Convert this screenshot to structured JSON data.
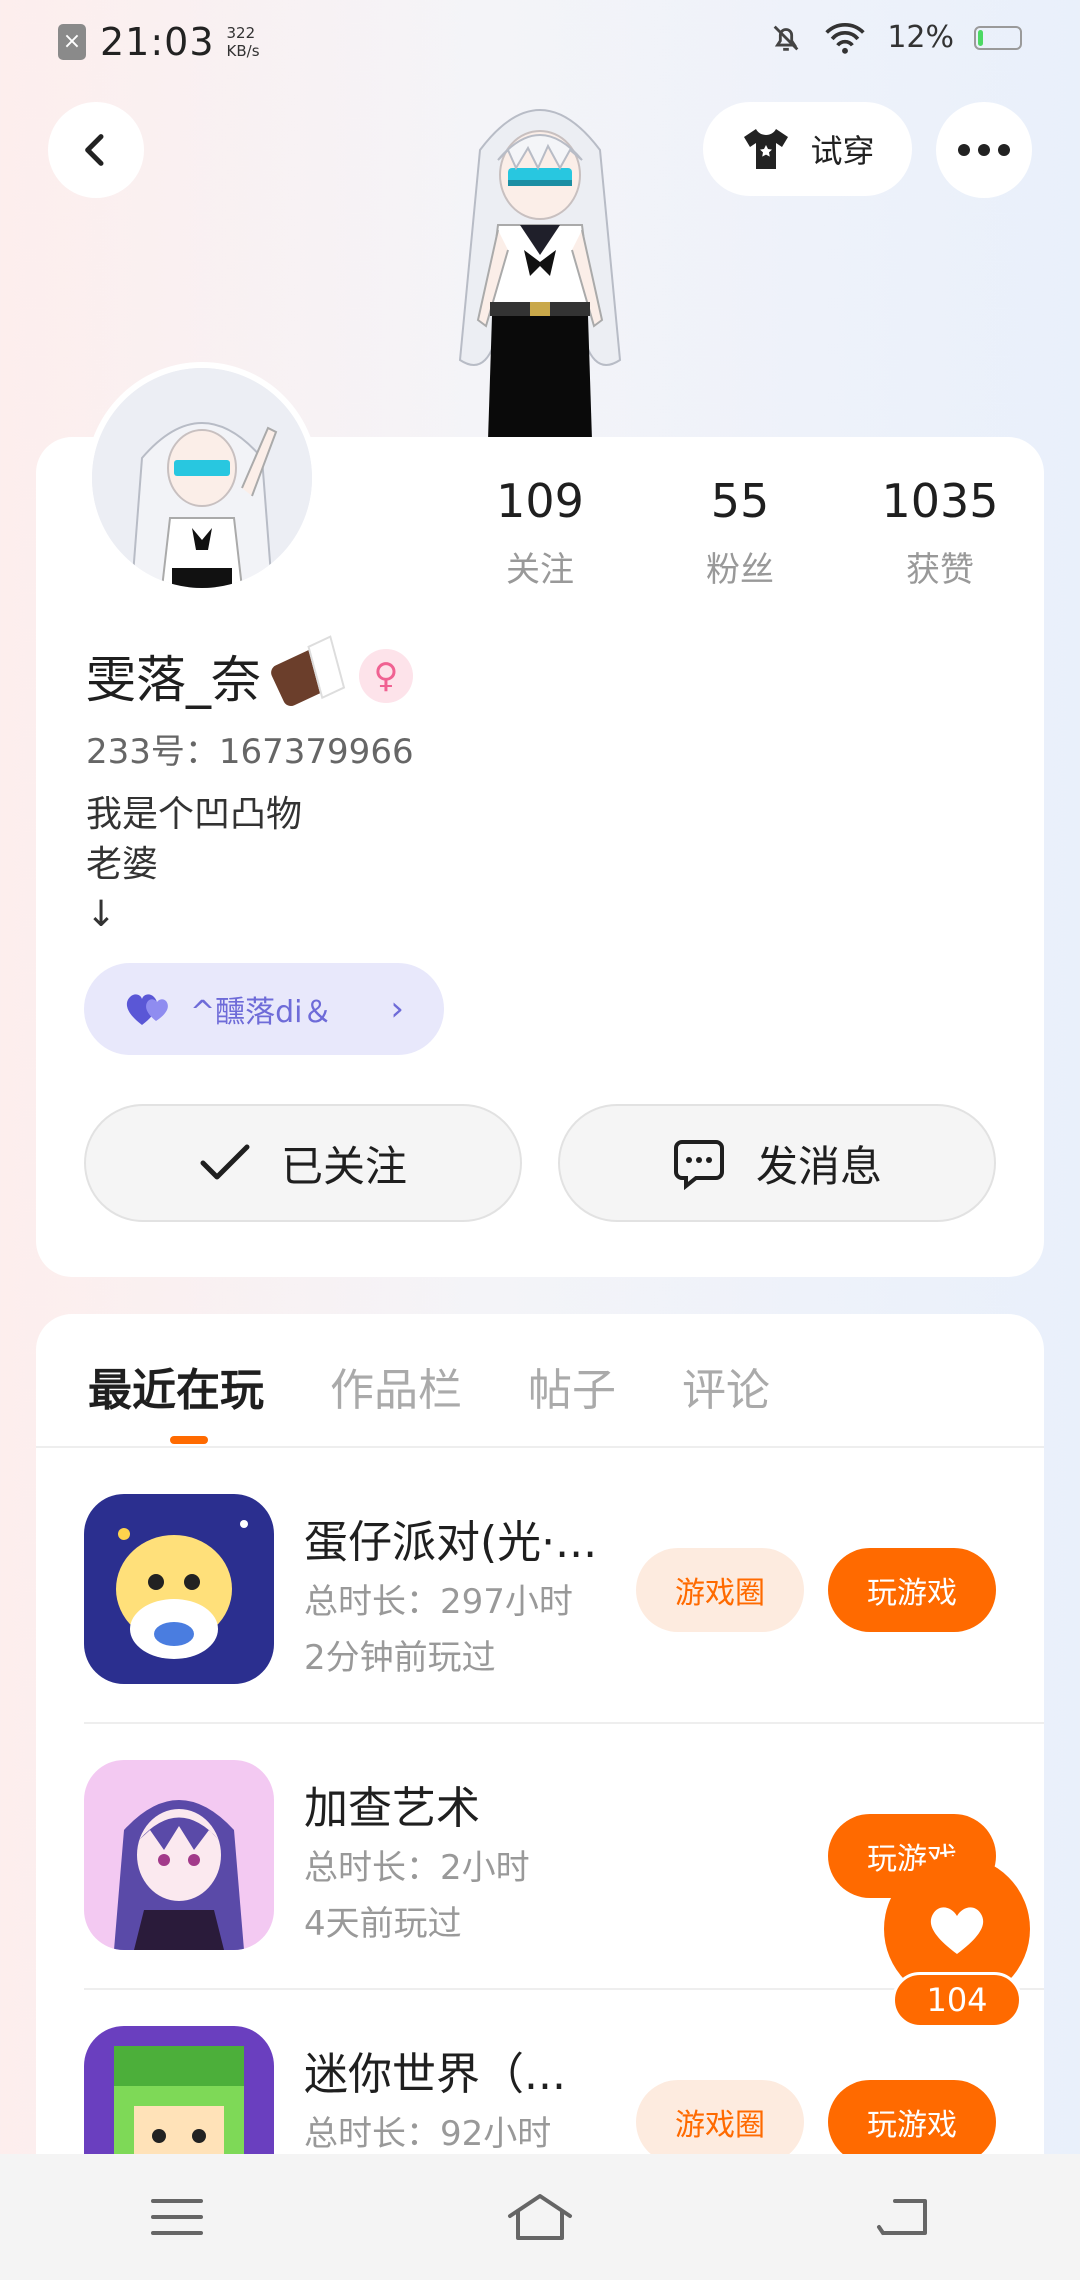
{
  "status_bar": {
    "time": "21:03",
    "speed_value": "322",
    "speed_unit": "KB/s",
    "battery_percent": "12%",
    "battery_level": 0.12
  },
  "header": {
    "back_icon": "chevron-left-icon",
    "tryon_label": "试穿",
    "more_icon": "more-dots-icon"
  },
  "profile": {
    "username": "雯落_奈",
    "gender_symbol": "♀",
    "uid": "233号：167379966",
    "bio": "我是个凹凸物\n老婆\n↓",
    "stats": [
      {
        "value": "109",
        "label": "关注"
      },
      {
        "value": "55",
        "label": "粉丝"
      },
      {
        "value": "1035",
        "label": "获赞"
      }
    ],
    "cp": {
      "name": "^醺落di＆",
      "icon": "double-heart-icon",
      "chevron": "›"
    },
    "follow_label": "已关注",
    "message_label": "发消息"
  },
  "tabs": [
    {
      "label": "最近在玩",
      "active": true
    },
    {
      "label": "作品栏",
      "active": false
    },
    {
      "label": "帖子",
      "active": false
    },
    {
      "label": "评论",
      "active": false
    }
  ],
  "games": [
    {
      "title": "蛋仔派对(光·...",
      "duration": "总时长：297小时",
      "last_played": "2分钟前玩过",
      "circle_label": "游戏圈",
      "play_label": "玩游戏"
    },
    {
      "title": "加查艺术",
      "duration": "总时长：2小时",
      "last_played": "4天前玩过",
      "circle_label": "",
      "play_label": "玩游戏"
    },
    {
      "title": "迷你世界（...",
      "duration": "总时长：92小时",
      "last_played": "",
      "circle_label": "游戏圈",
      "play_label": "玩游戏"
    }
  ],
  "like": {
    "count": "104"
  },
  "colors": {
    "accent": "#ff6a00",
    "cp_bg": "#e8e8fb",
    "cp_text": "#6e6bd8"
  }
}
